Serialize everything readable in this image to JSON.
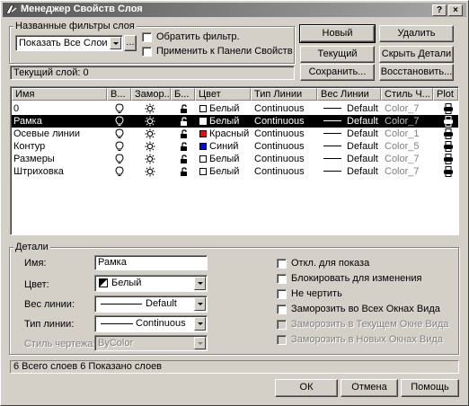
{
  "window": {
    "title": "Менеджер Свойств Слоя",
    "help": "?",
    "close": "×"
  },
  "filters": {
    "group_label": "Названные фильтры слоя",
    "selected": "Показать Все Слои",
    "more_button": "...",
    "invert_label": "Обратить фильтр.",
    "apply_label": "Применить к Панели Свойств Объ"
  },
  "current_layer": "Текущий слой:  0",
  "buttons": {
    "new": "Новый",
    "delete": "Удалить",
    "current": "Текущий",
    "hide_details": "Скрыть Детали",
    "save": "Сохранить...",
    "restore": "Восстановить...",
    "ok": "ОК",
    "cancel": "Отмена",
    "help": "Помощь"
  },
  "columns": [
    "Имя",
    "В...",
    "Замор...",
    "Б...",
    "Цвет",
    "Тип Линии",
    "Вес Линии",
    "Стиль Ч...",
    "Plot"
  ],
  "layers": [
    {
      "name": "0",
      "color_name": "Белый",
      "color_hex": "#ffffff",
      "linetype": "Continuous",
      "lineweight": "Default",
      "plotstyle": "Color_7",
      "selected": false
    },
    {
      "name": "Рамка",
      "color_name": "Белый",
      "color_hex": "#ffffff",
      "linetype": "Continuous",
      "lineweight": "Default",
      "plotstyle": "Color_7",
      "selected": true
    },
    {
      "name": "Осевые линии",
      "color_name": "Красный",
      "color_hex": "#ff0000",
      "linetype": "Continuous",
      "lineweight": "Default",
      "plotstyle": "Color_1",
      "selected": false
    },
    {
      "name": "Контур",
      "color_name": "Синий",
      "color_hex": "#0000ff",
      "linetype": "Continuous",
      "lineweight": "Default",
      "plotstyle": "Color_5",
      "selected": false
    },
    {
      "name": "Размеры",
      "color_name": "Белый",
      "color_hex": "#ffffff",
      "linetype": "Continuous",
      "lineweight": "Default",
      "plotstyle": "Color_7",
      "selected": false
    },
    {
      "name": "Штриховка",
      "color_name": "Белый",
      "color_hex": "#ffffff",
      "linetype": "Continuous",
      "lineweight": "Default",
      "plotstyle": "Color_7",
      "selected": false
    }
  ],
  "details": {
    "group_label": "Детали",
    "name_label": "Имя:",
    "name_value": "Рамка",
    "color_label": "Цвет:",
    "color_value": "Белый",
    "lineweight_label": "Вес линии:",
    "lineweight_value": "Default",
    "linetype_label": "Тип линии:",
    "linetype_value": "Continuous",
    "plotstyle_label": "Стиль чертежа:",
    "plotstyle_value": "ByColor",
    "off_label": "Откл. для показа",
    "lock_label": "Блокировать для изменения",
    "noplot_label": "Не чертить",
    "freeze_all_label": "Заморозить во Всех Окнах Вида",
    "freeze_current_label": "Заморозить в Текущем Окне Вида",
    "freeze_new_label": "Заморозить в Новых Окнах Вида"
  },
  "status": "6 Всего слоев   6 Показано слоев"
}
